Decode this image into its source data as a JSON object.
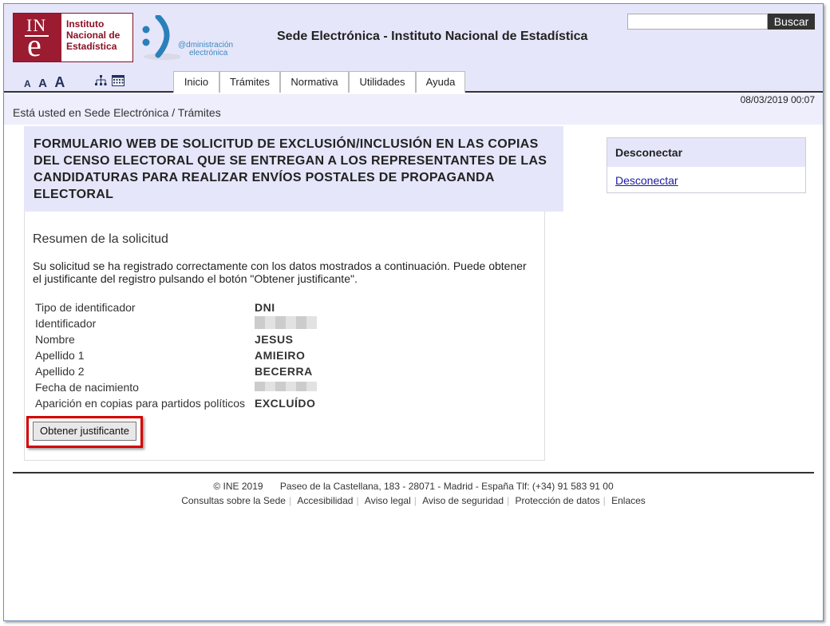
{
  "header": {
    "logo": {
      "text_line1": "Instituto",
      "text_line2": "Nacional de",
      "text_line3": "Estadística",
      "brand_color": "#9b1b30"
    },
    "adm_logo": {
      "line1": "@dministración",
      "line2": "electrónica"
    },
    "site_title": "Sede Electrónica - Instituto Nacional de Estadística",
    "search": {
      "value": "",
      "placeholder": "",
      "button_label": "Buscar"
    },
    "font_size_controls": [
      "A",
      "A",
      "A"
    ],
    "tool_icons": [
      "sitemap-icon",
      "calendar-icon"
    ]
  },
  "tabs": [
    {
      "label": "Inicio"
    },
    {
      "label": "Trámites"
    },
    {
      "label": "Normativa"
    },
    {
      "label": "Utilidades"
    },
    {
      "label": "Ayuda"
    }
  ],
  "datetime": "08/03/2019 00:07",
  "breadcrumb": {
    "prefix": "Está usted en",
    "item1": "Sede Electrónica",
    "separator": "/",
    "item2": "Trámites"
  },
  "main": {
    "title": "FORMULARIO WEB DE SOLICITUD DE EXCLUSIÓN/INCLUSIÓN EN LAS COPIAS DEL CENSO ELECTORAL QUE SE ENTREGAN A LOS REPRESENTANTES DE LAS CANDIDATURAS PARA REALIZAR ENVÍOS POSTALES DE PROPAGANDA ELECTORAL",
    "section_title": "Resumen de la solicitud",
    "description": "Su solicitud se ha registrado correctamente con los datos mostrados a continuación. Puede obtener el justificante del registro pulsando el botón \"Obtener justificante\".",
    "details": [
      {
        "label": "Tipo de identificador",
        "value": "DNI"
      },
      {
        "label": "Identificador",
        "value": ""
      },
      {
        "label": "Nombre",
        "value": "JESUS"
      },
      {
        "label": "Apellido 1",
        "value": "AMIEIRO"
      },
      {
        "label": "Apellido 2",
        "value": "BECERRA"
      },
      {
        "label": "Fecha de nacimiento",
        "value": ""
      },
      {
        "label": "Aparición en copias para partidos políticos",
        "value": "EXCLUÍDO"
      }
    ],
    "button_label": "Obtener justificante",
    "highlight_color": "#d40000"
  },
  "sidebar": {
    "heading": "Desconectar",
    "link": "Desconectar"
  },
  "footer": {
    "copyright": "©  INE 2019",
    "address": "Paseo de la Castellana, 183 - 28071 - Madrid - España Tlf: (+34) 91 583 91 00",
    "links": [
      "Consultas sobre la Sede",
      "Accesibilidad",
      "Aviso legal",
      "Aviso de seguridad",
      "Protección de datos",
      "Enlaces"
    ]
  }
}
